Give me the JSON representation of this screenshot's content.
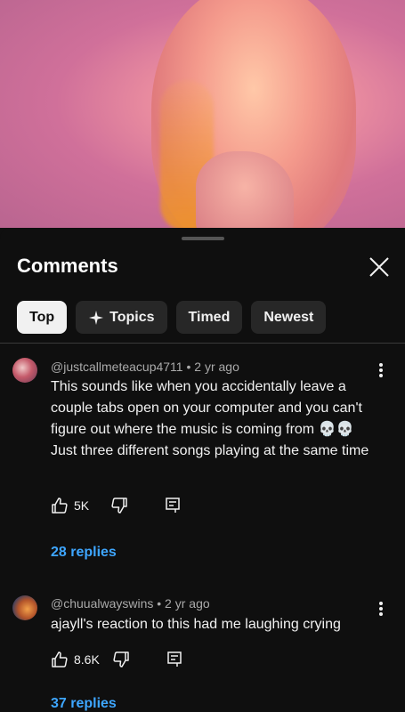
{
  "sheet": {
    "title": "Comments",
    "close_icon": "close-icon"
  },
  "chips": [
    {
      "label": "Top",
      "active": true
    },
    {
      "label": "Topics",
      "icon": "sparkle-icon"
    },
    {
      "label": "Timed"
    },
    {
      "label": "Newest"
    }
  ],
  "comments": [
    {
      "meta": "@justcallmeteacup4711 • 2 yr ago",
      "text": "This sounds like when you accidentally leave a couple tabs open on your computer and you can't figure out where the music is coming from 💀💀 Just three different songs playing at the same time",
      "likes": "5K",
      "replies": "28 replies"
    },
    {
      "meta": "@chuualwayswins • 2 yr ago",
      "text": "ajayll's reaction to this had me laughing crying",
      "likes": "8.6K",
      "replies": "37 replies"
    }
  ]
}
